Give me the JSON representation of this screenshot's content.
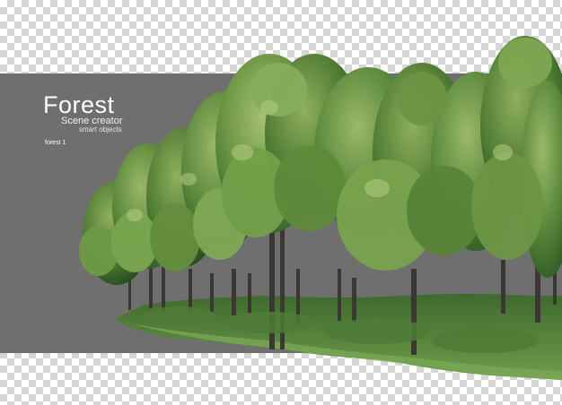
{
  "title": "Forest",
  "subtitle": "Scene creator",
  "subtitle_small": "smart objects",
  "label": "forest 1"
}
